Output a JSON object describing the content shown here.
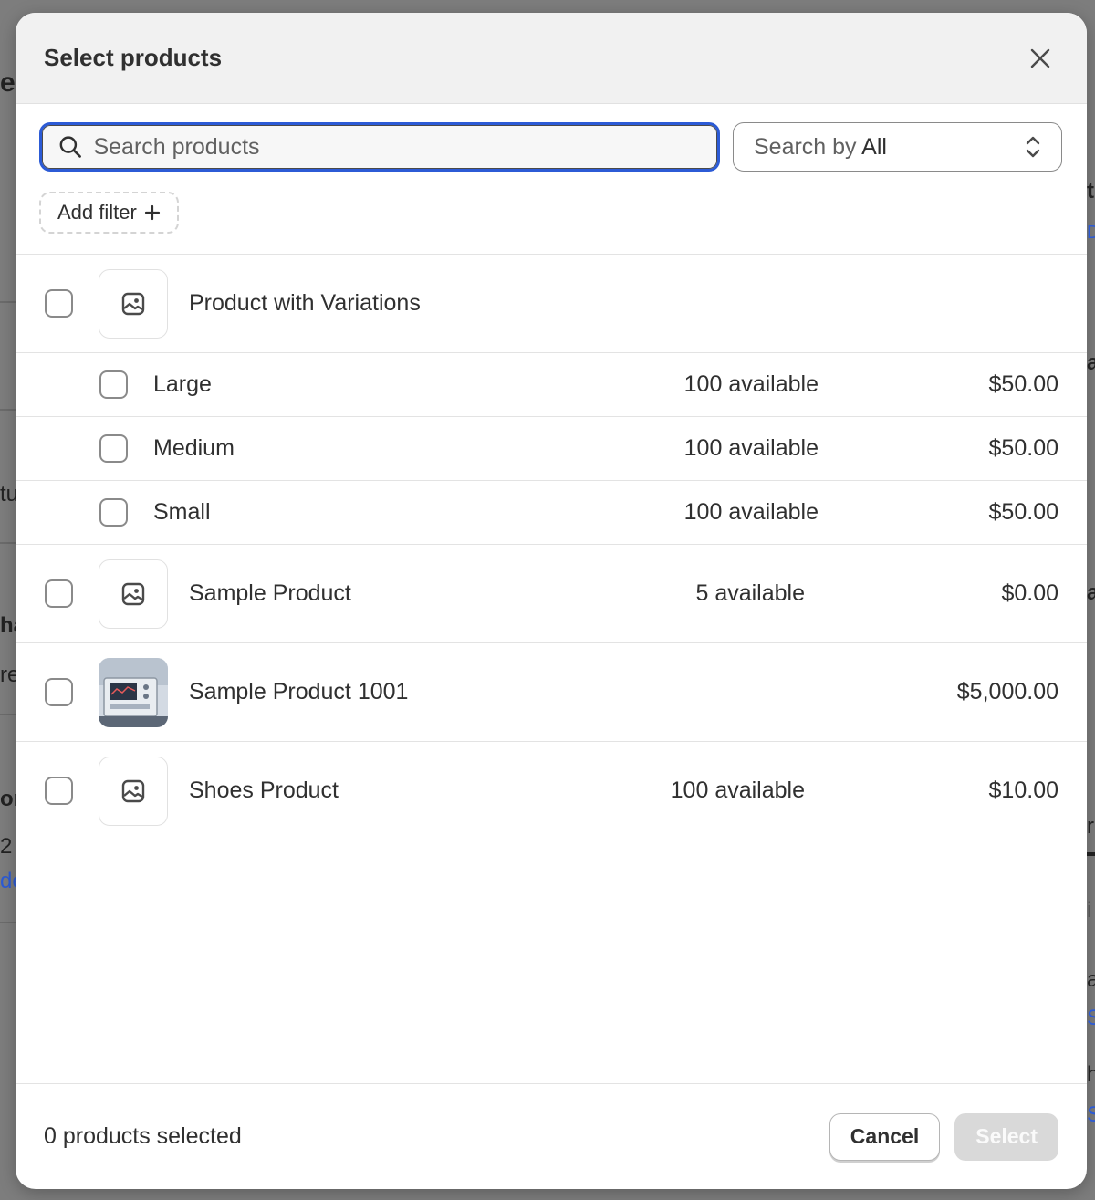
{
  "background": {
    "fragments": [
      "e",
      "tu",
      "ha",
      "re",
      "or",
      "2",
      "de",
      "t",
      "D",
      "a",
      "a",
      "r",
      "i",
      "a",
      "S",
      "h",
      "S"
    ]
  },
  "modal": {
    "title": "Select products",
    "close_icon": "close-icon",
    "search": {
      "placeholder": "Search products",
      "value": "",
      "icon": "search-icon"
    },
    "search_by": {
      "label": "Search by",
      "value": "All",
      "icon": "up-down-chevron-icon"
    },
    "add_filter": {
      "label": "Add filter",
      "icon": "plus-icon"
    },
    "products": [
      {
        "name": "Product with Variations",
        "image": "image-placeholder-icon",
        "variants": [
          {
            "name": "Large",
            "availability": "100 available",
            "price": "$50.00"
          },
          {
            "name": "Medium",
            "availability": "100 available",
            "price": "$50.00"
          },
          {
            "name": "Small",
            "availability": "100 available",
            "price": "$50.00"
          }
        ]
      },
      {
        "name": "Sample Product",
        "image": "image-placeholder-icon",
        "availability": "5 available",
        "price": "$0.00"
      },
      {
        "name": "Sample Product 1001",
        "image": "product-photo",
        "availability": "",
        "price": "$5,000.00"
      },
      {
        "name": "Shoes Product",
        "image": "image-placeholder-icon",
        "availability": "100 available",
        "price": "$10.00"
      }
    ],
    "footer": {
      "selected_count": "0 products selected",
      "cancel_label": "Cancel",
      "select_label": "Select"
    }
  },
  "colors": {
    "focus_ring": "#2c5bd6",
    "overlay": "#7d7d7d",
    "disabled_button": "#d9d9d9"
  }
}
